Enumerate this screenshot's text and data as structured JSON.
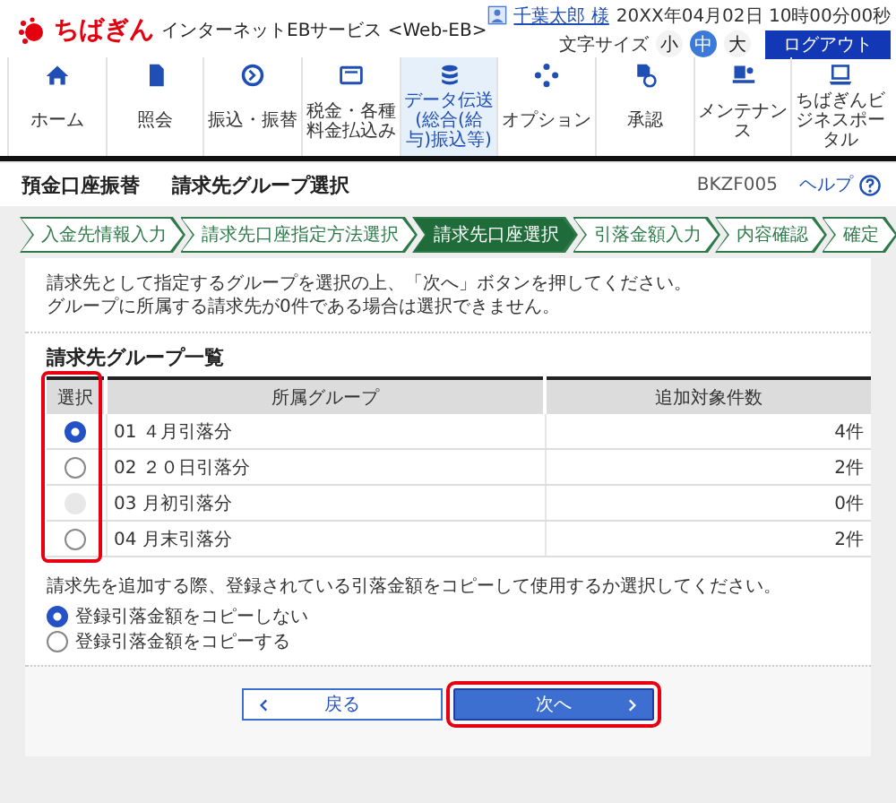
{
  "header": {
    "brand": "ちばぎん",
    "service": "インターネットEBサービス <Web-EB>",
    "user_name": "千葉太郎 様",
    "datetime": "20XX年04月02日 10時00分00秒",
    "font_size_label": "文字サイズ",
    "logout": "ログアウト",
    "font_sizes": [
      {
        "label": "小",
        "selected": false
      },
      {
        "label": "中",
        "selected": true
      },
      {
        "label": "大",
        "selected": false
      }
    ]
  },
  "nav": [
    {
      "kind": "home",
      "label": "ホーム",
      "selected": false
    },
    {
      "kind": "document",
      "label": "照会",
      "selected": false
    },
    {
      "kind": "transfer",
      "label": "振込・振替",
      "selected": false
    },
    {
      "kind": "bill",
      "label": "税金・各種料金払込み",
      "selected": false
    },
    {
      "kind": "database",
      "label": "データ伝送",
      "sublabel": "(総合(給与)振込等)",
      "selected": true
    },
    {
      "kind": "option",
      "label": "オプション",
      "selected": false
    },
    {
      "kind": "approval",
      "label": "承認",
      "selected": false
    },
    {
      "kind": "maintenance",
      "label": "メンテナンス",
      "selected": false
    },
    {
      "kind": "portal",
      "label": "ちばぎんビジネスポータル",
      "selected": false
    }
  ],
  "page": {
    "section": "預金口座振替",
    "title": "請求先グループ選択",
    "screen_id": "BKZF005",
    "help": "ヘルプ"
  },
  "steps": [
    {
      "label": "入金先情報入力",
      "selected": false
    },
    {
      "label": "請求先口座指定方法選択",
      "selected": false
    },
    {
      "label": "請求先口座選択",
      "selected": true
    },
    {
      "label": "引落金額入力",
      "selected": false
    },
    {
      "label": "内容確認",
      "selected": false
    },
    {
      "label": "確定",
      "selected": false
    }
  ],
  "instructions": [
    "請求先として指定するグループを選択の上、「次へ」ボタンを押してください。",
    "グループに所属する請求先が0件である場合は選択できません。"
  ],
  "group_table": {
    "heading": "請求先グループ一覧",
    "columns": [
      "選択",
      "所属グループ",
      "追加対象件数"
    ],
    "select_column_highlighted": true,
    "rows": [
      {
        "group": "01 ４月引落分",
        "count": "4件",
        "selected": true,
        "disabled": false
      },
      {
        "group": "02 ２０日引落分",
        "count": "2件",
        "selected": false,
        "disabled": false
      },
      {
        "group": "03 月初引落分",
        "count": "0件",
        "selected": false,
        "disabled": true
      },
      {
        "group": "04 月末引落分",
        "count": "2件",
        "selected": false,
        "disabled": false
      }
    ]
  },
  "copy_option": {
    "prompt": "請求先を追加する際、登録されている引落金額をコピーして使用するか選択してください。",
    "options": [
      {
        "label": "登録引落金額をコピーしない",
        "selected": true
      },
      {
        "label": "登録引落金額をコピーする",
        "selected": false
      }
    ]
  },
  "buttons": [
    {
      "kind": "back",
      "label": "戻る",
      "highlighted": false
    },
    {
      "kind": "next",
      "label": "次へ",
      "highlighted": true
    }
  ]
}
